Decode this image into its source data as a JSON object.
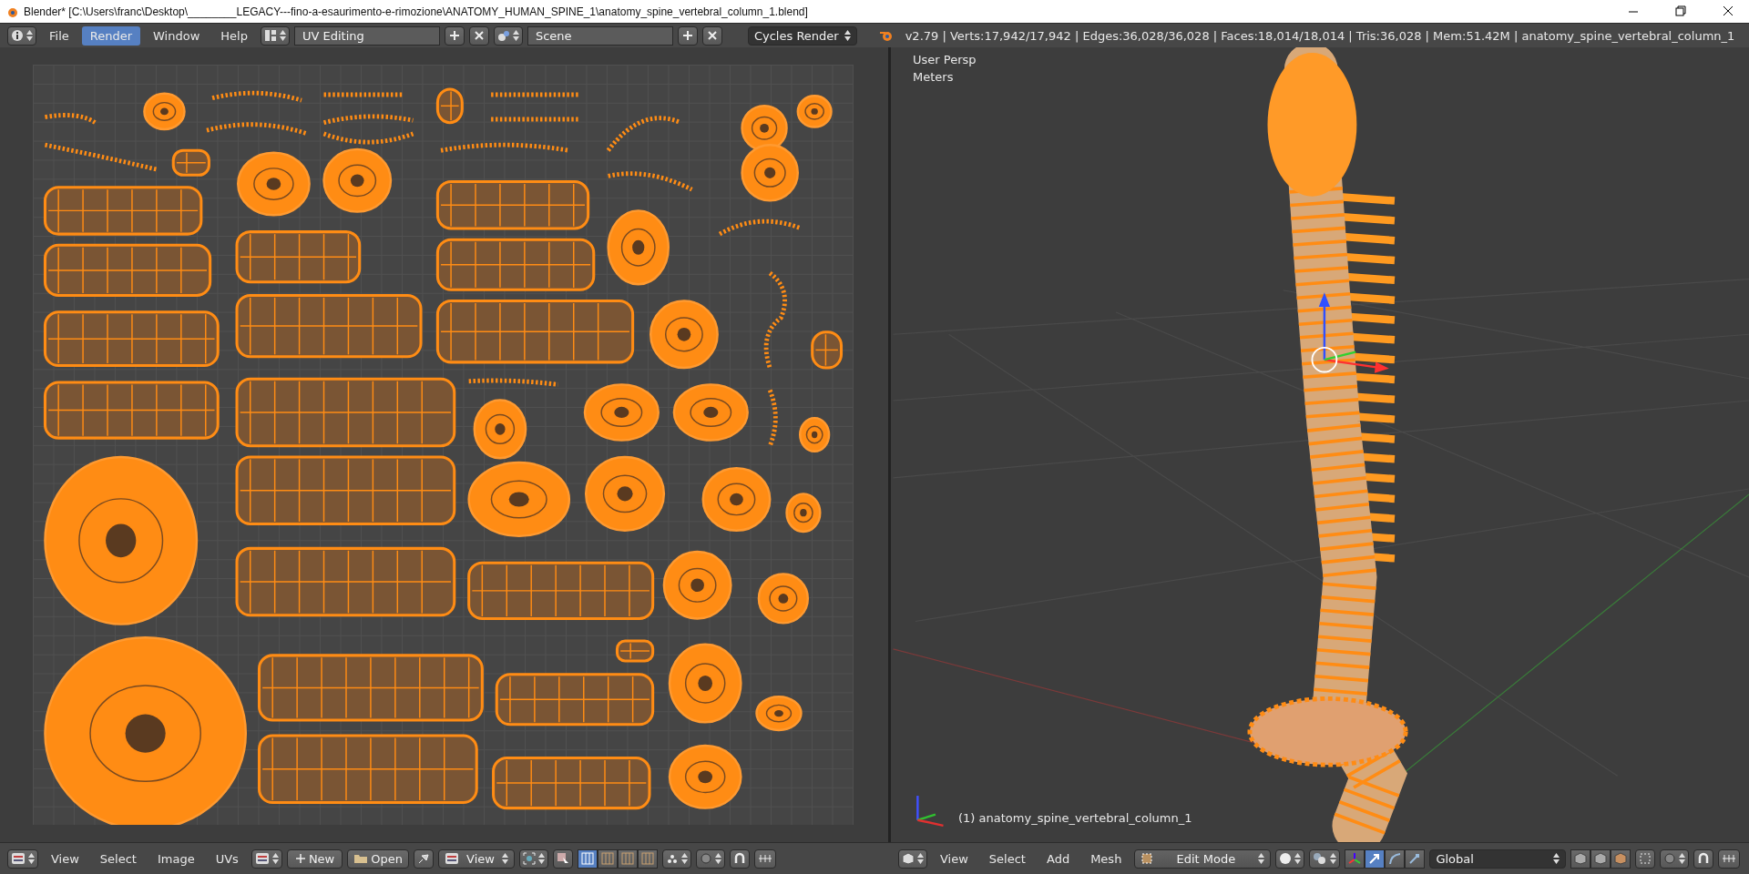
{
  "title_bar": {
    "title": "Blender* [C:\\Users\\franc\\Desktop\\________LEGACY---fino-a-esaurimento-e-rimozione\\ANATOMY_HUMAN_SPINE_1\\anatomy_spine_vertebral_column_1.blend]"
  },
  "info_header": {
    "menus": [
      {
        "label": "File",
        "selected": false
      },
      {
        "label": "Render",
        "selected": true
      },
      {
        "label": "Window",
        "selected": false
      },
      {
        "label": "Help",
        "selected": false
      }
    ],
    "screen_layout": "UV Editing",
    "scene": "Scene",
    "render_engine": "Cycles Render",
    "stats": "v2.79 | Verts:17,942/17,942 | Edges:36,028/36,028 | Faces:18,014/18,014 | Tris:36,028 | Mem:51.42M | anatomy_spine_vertebral_column_1"
  },
  "viewport": {
    "view_name": "User Persp",
    "units": "Meters",
    "object_label": "(1) anatomy_spine_vertebral_column_1"
  },
  "uv_header": {
    "menus": [
      "View",
      "Select",
      "Image",
      "UVs"
    ],
    "new_button": "New",
    "open_button": "Open",
    "view_mode": "View",
    "select_modes": [
      {
        "selected": true
      },
      {
        "selected": false
      },
      {
        "selected": false
      },
      {
        "selected": false
      }
    ]
  },
  "view3d_header": {
    "menus": [
      "View",
      "Select",
      "Add",
      "Mesh"
    ],
    "mode": "Edit Mode",
    "orientation": "Global",
    "transform_widgets": [
      {
        "selected": false
      },
      {
        "selected": true
      },
      {
        "selected": false
      },
      {
        "selected": false
      }
    ]
  }
}
